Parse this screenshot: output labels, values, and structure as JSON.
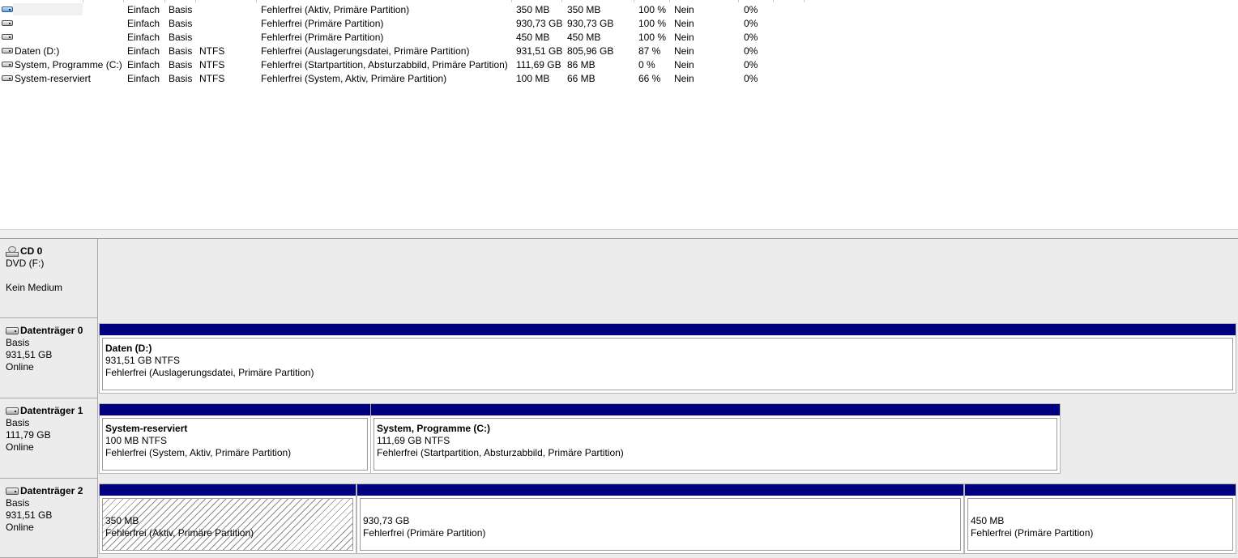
{
  "volumes": [
    {
      "name": "",
      "layout": "Einfach",
      "type": "Basis",
      "fs": "",
      "status": "Fehlerfrei (Aktiv, Primäre Partition)",
      "capacity": "350 MB",
      "free": "350 MB",
      "free_pct": "100 %",
      "fault_tolerance": "Nein",
      "overhead": "0%",
      "icon": "volume-blue-icon"
    },
    {
      "name": "",
      "layout": "Einfach",
      "type": "Basis",
      "fs": "",
      "status": "Fehlerfrei (Primäre Partition)",
      "capacity": "930,73 GB",
      "free": "930,73 GB",
      "free_pct": "100 %",
      "fault_tolerance": "Nein",
      "overhead": "0%",
      "icon": "volume-icon"
    },
    {
      "name": "",
      "layout": "Einfach",
      "type": "Basis",
      "fs": "",
      "status": "Fehlerfrei (Primäre Partition)",
      "capacity": "450 MB",
      "free": "450 MB",
      "free_pct": "100 %",
      "fault_tolerance": "Nein",
      "overhead": "0%",
      "icon": "volume-icon"
    },
    {
      "name": "Daten (D:)",
      "layout": "Einfach",
      "type": "Basis",
      "fs": "NTFS",
      "status": "Fehlerfrei (Auslagerungsdatei, Primäre Partition)",
      "capacity": "931,51 GB",
      "free": "805,96 GB",
      "free_pct": "87 %",
      "fault_tolerance": "Nein",
      "overhead": "0%",
      "icon": "volume-icon"
    },
    {
      "name": "System, Programme (C:)",
      "layout": "Einfach",
      "type": "Basis",
      "fs": "NTFS",
      "status": "Fehlerfrei (Startpartition, Absturzabbild, Primäre Partition)",
      "capacity": "111,69 GB",
      "free": "86 MB",
      "free_pct": "0 %",
      "fault_tolerance": "Nein",
      "overhead": "0%",
      "icon": "volume-icon"
    },
    {
      "name": "System-reserviert",
      "layout": "Einfach",
      "type": "Basis",
      "fs": "NTFS",
      "status": "Fehlerfrei (System, Aktiv, Primäre Partition)",
      "capacity": "100 MB",
      "free": "66 MB",
      "free_pct": "66 %",
      "fault_tolerance": "Nein",
      "overhead": "0%",
      "icon": "volume-icon"
    }
  ],
  "disks": [
    {
      "title": "CD 0",
      "icon": "cd-drive-icon",
      "lines": [
        "DVD (F:)",
        "",
        "Kein Medium"
      ],
      "partitions": []
    },
    {
      "title": "Datenträger 0",
      "icon": "disk-icon",
      "lines": [
        "Basis",
        "931,51 GB",
        "Online"
      ],
      "partitions": [
        {
          "name": "Daten  (D:)",
          "size": "931,51 GB NTFS",
          "status": "Fehlerfrei (Auslagerungsdatei, Primäre Partition)",
          "hatched": false
        }
      ]
    },
    {
      "title": "Datenträger 1",
      "icon": "disk-icon",
      "lines": [
        "Basis",
        "111,79 GB",
        "Online"
      ],
      "partitions": [
        {
          "name": "System-reserviert",
          "size": "100 MB NTFS",
          "status": "Fehlerfrei (System, Aktiv, Primäre Partition)",
          "hatched": false
        },
        {
          "name": "System, Programme  (C:)",
          "size": "111,69 GB NTFS",
          "status": "Fehlerfrei (Startpartition, Absturzabbild, Primäre Partition)",
          "hatched": false
        }
      ]
    },
    {
      "title": "Datenträger 2",
      "icon": "disk-icon",
      "lines": [
        "Basis",
        "931,51 GB",
        "Online"
      ],
      "partitions": [
        {
          "name": "",
          "size": "350 MB",
          "status": "Fehlerfrei (Aktiv, Primäre Partition)",
          "hatched": true
        },
        {
          "name": "",
          "size": "930,73 GB",
          "status": "Fehlerfrei (Primäre Partition)",
          "hatched": false
        },
        {
          "name": "",
          "size": "450 MB",
          "status": "Fehlerfrei (Primäre Partition)",
          "hatched": false
        }
      ]
    }
  ],
  "colors": {
    "partition_bar": "#000080",
    "panel_bg": "#ececec"
  }
}
